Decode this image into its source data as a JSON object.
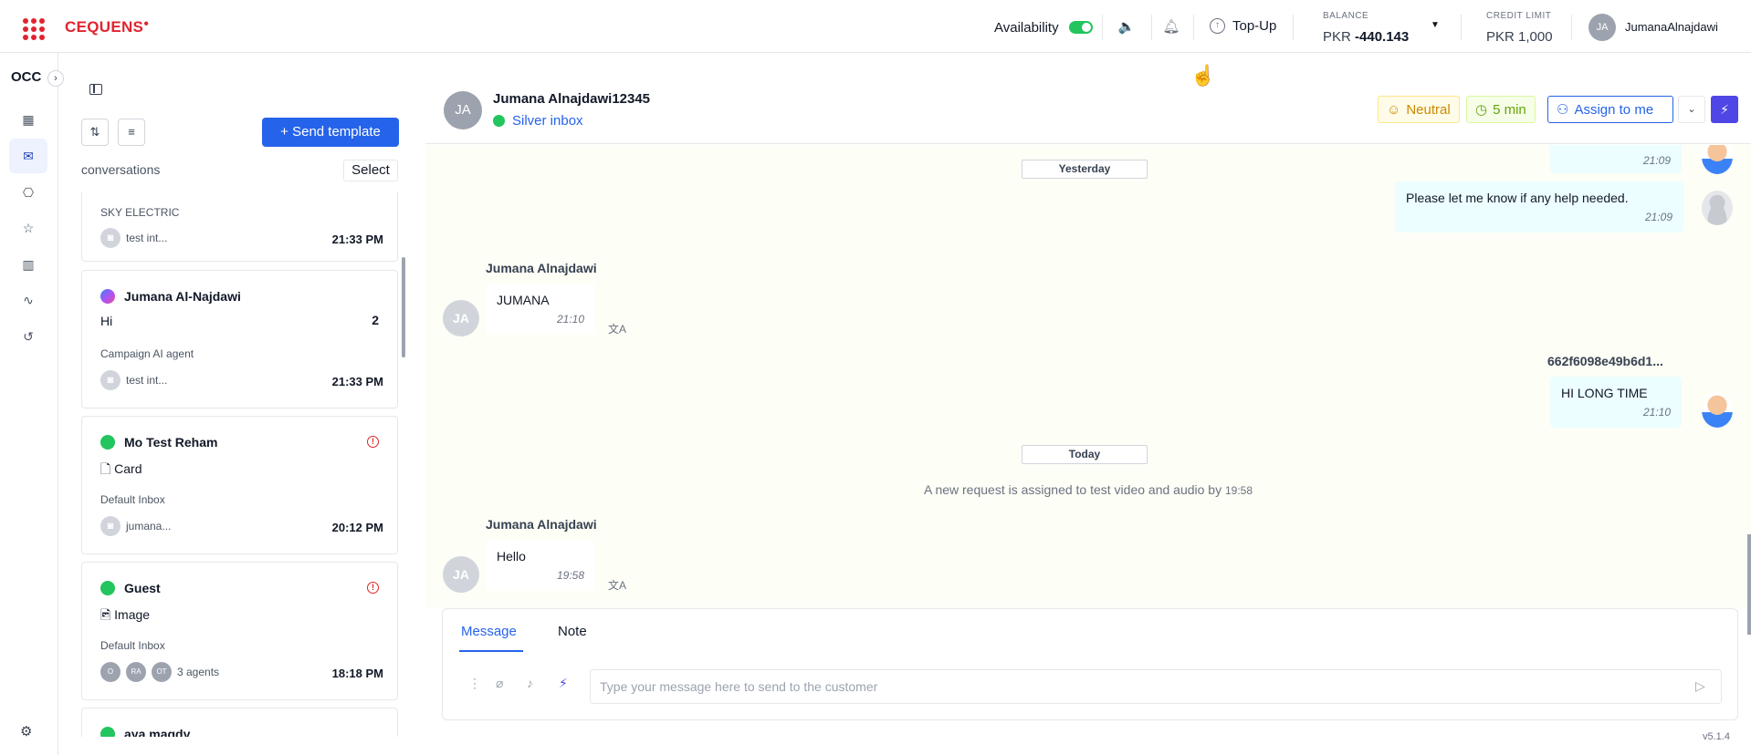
{
  "brand": {
    "name": "CEQUENS",
    "accent": "#e0242f"
  },
  "topbar": {
    "availability_label": "Availability",
    "availability_on": true,
    "topup_label": "Top-Up",
    "balance_label": "BALANCE",
    "balance_currency": "PKR",
    "balance_value": "-440.143",
    "credit_label": "CREDIT LIMIT",
    "credit_value": "PKR 1,000",
    "user_initials": "JA",
    "user_name": "JumanaAlnajdawi"
  },
  "rail": {
    "title": "OCC",
    "icons": [
      "dashboard-icon",
      "inbox-icon",
      "bot-icon",
      "star-icon",
      "chart-icon",
      "activity-icon",
      "history-icon",
      "settings-icon"
    ]
  },
  "conversations": {
    "send_template_label": "Send template",
    "list_label": "conversations",
    "select_label": "Select",
    "items": [
      {
        "subtitle": "SKY ELECTRIC",
        "agent": "test int...",
        "time": "21:33 PM"
      },
      {
        "name": "Jumana Al-Najdawi",
        "channel": "messenger",
        "message": "Hi",
        "count": "2",
        "subtitle": "Campaign AI agent",
        "agent": "test int...",
        "time": "21:33 PM"
      },
      {
        "name": "Mo Test Reham",
        "channel": "whatsapp",
        "message": "Card",
        "subtitle": "Default Inbox",
        "agent": "jumana...",
        "time": "20:12 PM"
      },
      {
        "name": "Guest",
        "channel": "whatsapp",
        "message": "Image",
        "subtitle": "Default Inbox",
        "agents": [
          "O",
          "RA",
          "OT"
        ],
        "agent": "3 agents",
        "time": "18:18 PM"
      },
      {
        "name": "aya magdy",
        "channel": "whatsapp"
      }
    ]
  },
  "chat": {
    "contact_initials": "JA",
    "contact_name": "Jumana Alnajdawi12345",
    "inbox": "Silver inbox",
    "sentiment": "Neutral",
    "timer": "5 min",
    "assign_label": "Assign to me",
    "messages": {
      "top_out_time": "21:09",
      "yesterday_label": "Yesterday",
      "help_text": "Please let me know if any help needed.",
      "help_time": "21:09",
      "sender1": "Jumana Alnajdawi",
      "jumana_text": "JUMANA",
      "jumana_time": "21:10",
      "agent_id": "662f6098e49b6d1...",
      "hi_text": "HI LONG TIME",
      "hi_time": "21:10",
      "today_label": "Today",
      "system_text": "A new request is assigned to test video and audio by",
      "system_time": "19:58",
      "sender2": "Jumana Alnajdawi",
      "hello_text": "Hello",
      "hello_time": "19:58",
      "avatar_initials": "JA"
    }
  },
  "composer": {
    "tab_message": "Message",
    "tab_note": "Note",
    "placeholder": "Type your message here to send to the customer"
  },
  "version": "v5.1.4"
}
